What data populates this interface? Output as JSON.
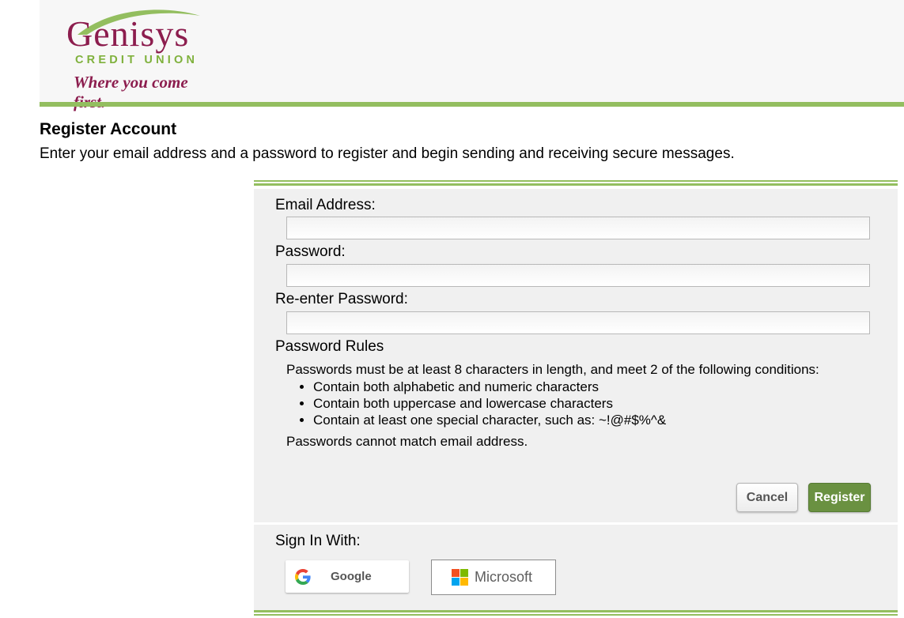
{
  "logo": {
    "name": "Genisys",
    "subtitle": "CREDIT UNION",
    "tagline": "Where you come first."
  },
  "page": {
    "title": "Register Account",
    "description": "Enter your email address and a password to register and begin sending and receiving secure messages."
  },
  "form": {
    "email_label": "Email Address:",
    "email_value": "",
    "password_label": "Password:",
    "password_value": "",
    "reenter_label": "Re-enter Password:",
    "reenter_value": ""
  },
  "rules": {
    "heading": "Password Rules",
    "intro": "Passwords must be at least 8 characters in length, and meet 2 of the following conditions:",
    "items": [
      "Contain both alphabetic and numeric characters",
      "Contain both uppercase and lowercase characters",
      "Contain at least one special character, such as: ~!@#$%^&"
    ],
    "note": "Passwords cannot match email address."
  },
  "buttons": {
    "cancel": "Cancel",
    "register": "Register"
  },
  "signin": {
    "label": "Sign In With:",
    "google": "Google",
    "microsoft": "Microsoft"
  },
  "colors": {
    "brand": "#8c1d4e",
    "accent": "#93be5f",
    "register_button": "#6a9141"
  },
  "icons": [
    "google-icon",
    "microsoft-icon"
  ]
}
